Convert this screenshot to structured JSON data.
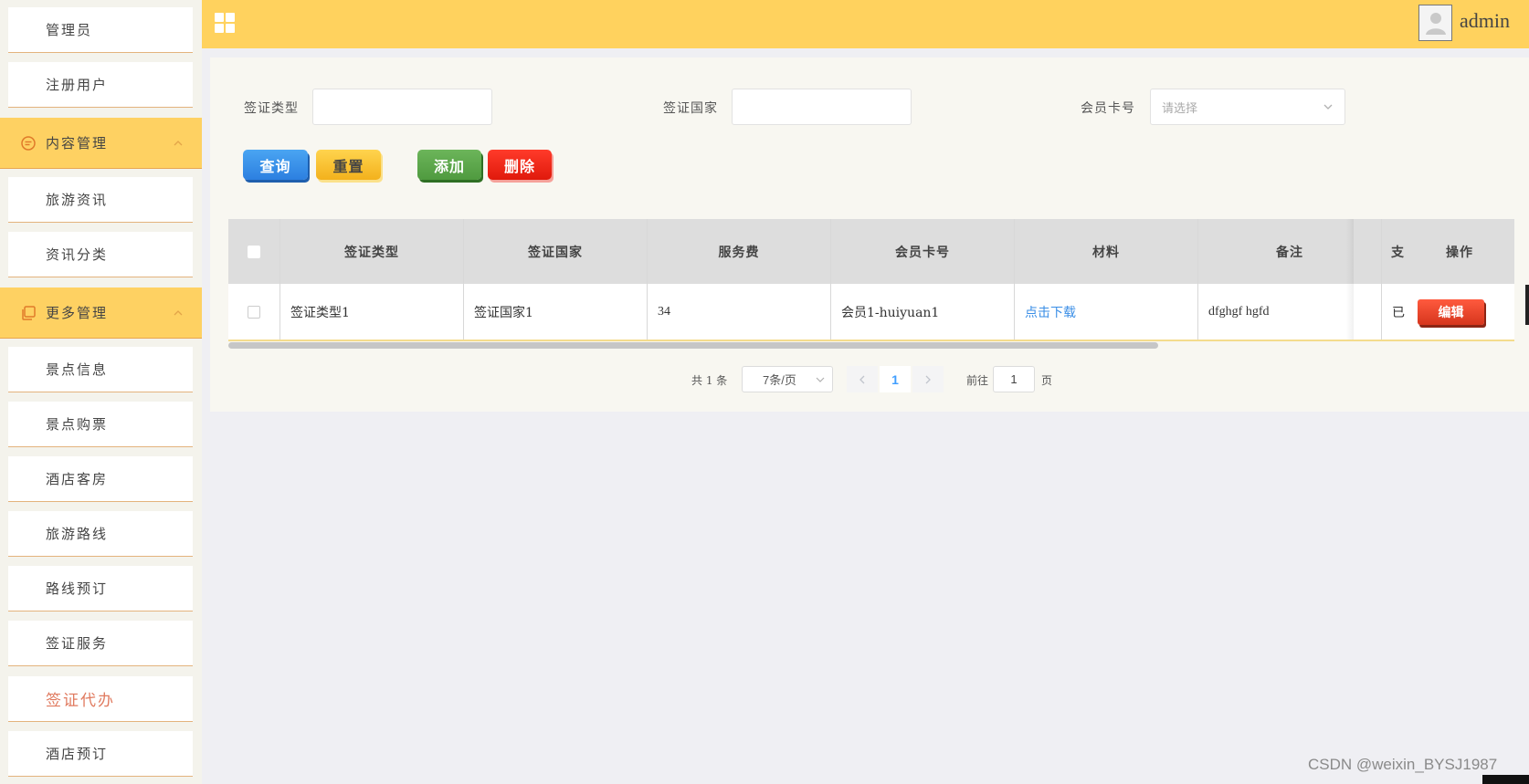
{
  "sidebar": {
    "items_top": [
      {
        "label": "管理员"
      },
      {
        "label": "注册用户"
      }
    ],
    "group_content": {
      "label": "内容管理",
      "icon": "message-icon"
    },
    "items_content": [
      {
        "label": "旅游资讯"
      },
      {
        "label": "资讯分类"
      }
    ],
    "group_more": {
      "label": "更多管理",
      "icon": "copy-icon"
    },
    "items_more": [
      {
        "label": "景点信息"
      },
      {
        "label": "景点购票"
      },
      {
        "label": "酒店客房"
      },
      {
        "label": "旅游路线"
      },
      {
        "label": "路线预订"
      },
      {
        "label": "签证服务"
      },
      {
        "label": "签证代办",
        "active": true
      },
      {
        "label": "酒店预订"
      }
    ]
  },
  "header": {
    "username": "admin",
    "menu_icon": "grid-icon",
    "avatar_icon": "user-avatar-icon"
  },
  "search": {
    "visa_type_label": "签证类型",
    "visa_type_value": "",
    "visa_country_label": "签证国家",
    "visa_country_value": "",
    "member_card_label": "会员卡号",
    "member_card_placeholder": "请选择"
  },
  "buttons": {
    "query": "查询",
    "reset": "重置",
    "add": "添加",
    "delete": "删除"
  },
  "table": {
    "columns": [
      "签证类型",
      "签证国家",
      "服务费",
      "会员卡号",
      "材料",
      "备注",
      "支",
      "操作"
    ],
    "rows": [
      {
        "visa_type": "签证类型1",
        "visa_country": "签证国家1",
        "fee": "34",
        "member_card": "会员1-huiyuan1",
        "material": "点击下载",
        "remark": "dfghgf hgfd",
        "paid": "已",
        "edit": "编辑"
      }
    ]
  },
  "pagination": {
    "total": "共 1 条",
    "page_size": "7条/页",
    "current_page": "1",
    "goto_label": "前往",
    "goto_value": "1",
    "page_suffix": "页"
  },
  "watermark": "CSDN @weixin_BYSJ1987",
  "colors": {
    "header": "#ffd25e",
    "sidebar_group": "#fed162",
    "query": "#2c7fe0",
    "add": "#4f9a3f",
    "delete": "#e01a0c",
    "edit": "#d6361d",
    "link": "#3a8ee6"
  }
}
